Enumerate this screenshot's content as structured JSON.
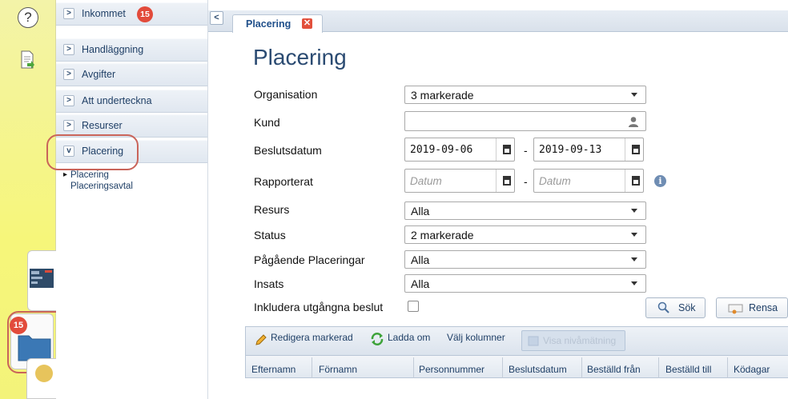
{
  "rail": {
    "help_symbol": "?",
    "badge": "15"
  },
  "nav": {
    "items": [
      {
        "label": "Inkommet",
        "badge": "15"
      },
      {
        "label": "Handläggning"
      },
      {
        "label": "Avgifter"
      },
      {
        "label": "Att underteckna"
      },
      {
        "label": "Resurser"
      },
      {
        "label": "Placering"
      }
    ],
    "subitems": [
      "Placering",
      "Placeringsavtal"
    ]
  },
  "tabs": [
    {
      "label": "Placering",
      "close_symbol": "✕"
    }
  ],
  "form": {
    "title": "Placering",
    "labels": {
      "organisation": "Organisation",
      "kund": "Kund",
      "beslutsdatum": "Beslutsdatum",
      "rapporterat": "Rapporterat",
      "resurs": "Resurs",
      "status": "Status",
      "pagaende": "Pågående Placeringar",
      "insats": "Insats",
      "inkludera": "Inkludera utgångna beslut"
    },
    "values": {
      "organisation": "3 markerade",
      "kund": "",
      "beslut_from": "2019-09-06",
      "beslut_to": "2019-09-13",
      "rapp_from_placeholder": "Datum",
      "rapp_to_placeholder": "Datum",
      "resurs": "Alla",
      "status": "2 markerade",
      "pagaende": "Alla",
      "insats": "Alla",
      "inkludera_checked": false
    },
    "dash": "-",
    "info_symbol": "i",
    "buttons": {
      "search": "Sök",
      "clear": "Rensa"
    }
  },
  "grid": {
    "toolbar": {
      "edit": "Redigera markerad",
      "reload": "Ladda om",
      "columns": "Välj kolumner",
      "level": "Visa nivåmätning"
    },
    "columns": [
      "Efternamn",
      "Förnamn",
      "Personnummer",
      "Beslutsdatum",
      "Beställd från",
      "Beställd till",
      "Ködagar"
    ]
  },
  "colors": {
    "accent": "#2b4b72",
    "badge": "#e24b3b",
    "rail": "#f6f67a",
    "highlight": "#c9645a"
  }
}
